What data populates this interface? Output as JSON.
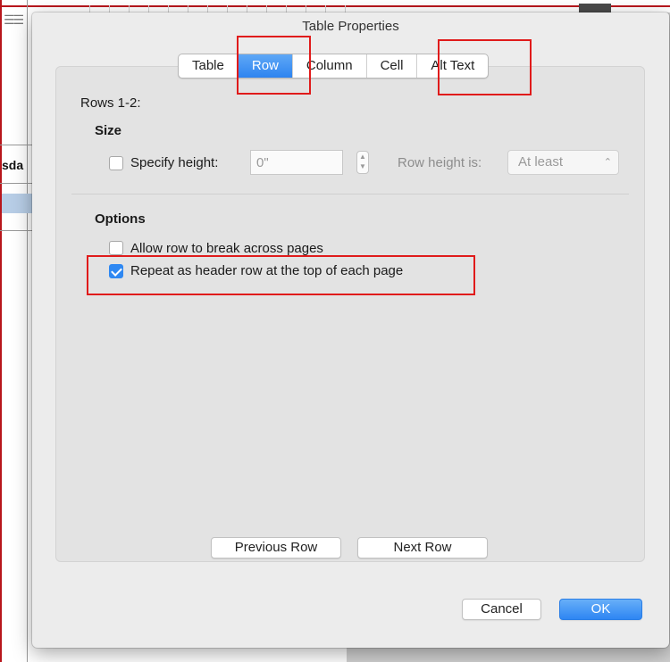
{
  "background_document": {
    "cell_text": "sda"
  },
  "dialog": {
    "title": "Table Properties",
    "tabs": [
      {
        "label": "Table",
        "active": false
      },
      {
        "label": "Row",
        "active": true
      },
      {
        "label": "Column",
        "active": false
      },
      {
        "label": "Cell",
        "active": false
      },
      {
        "label": "Alt Text",
        "active": false
      }
    ],
    "rows_label": "Rows 1-2:",
    "size": {
      "heading": "Size",
      "specify_height_label": "Specify height:",
      "specify_height_checked": false,
      "height_value": "0\"",
      "row_height_is_label": "Row height is:",
      "row_height_is_value": "At least"
    },
    "options": {
      "heading": "Options",
      "allow_break_label": "Allow row to break across pages",
      "allow_break_checked": false,
      "repeat_header_label": "Repeat as header row at the top of each page",
      "repeat_header_checked": true
    },
    "buttons": {
      "previous_row": "Previous Row",
      "next_row": "Next Row",
      "cancel": "Cancel",
      "ok": "OK"
    }
  },
  "colors": {
    "accent": "#2e84f0",
    "annotation": "#e01b1b"
  }
}
